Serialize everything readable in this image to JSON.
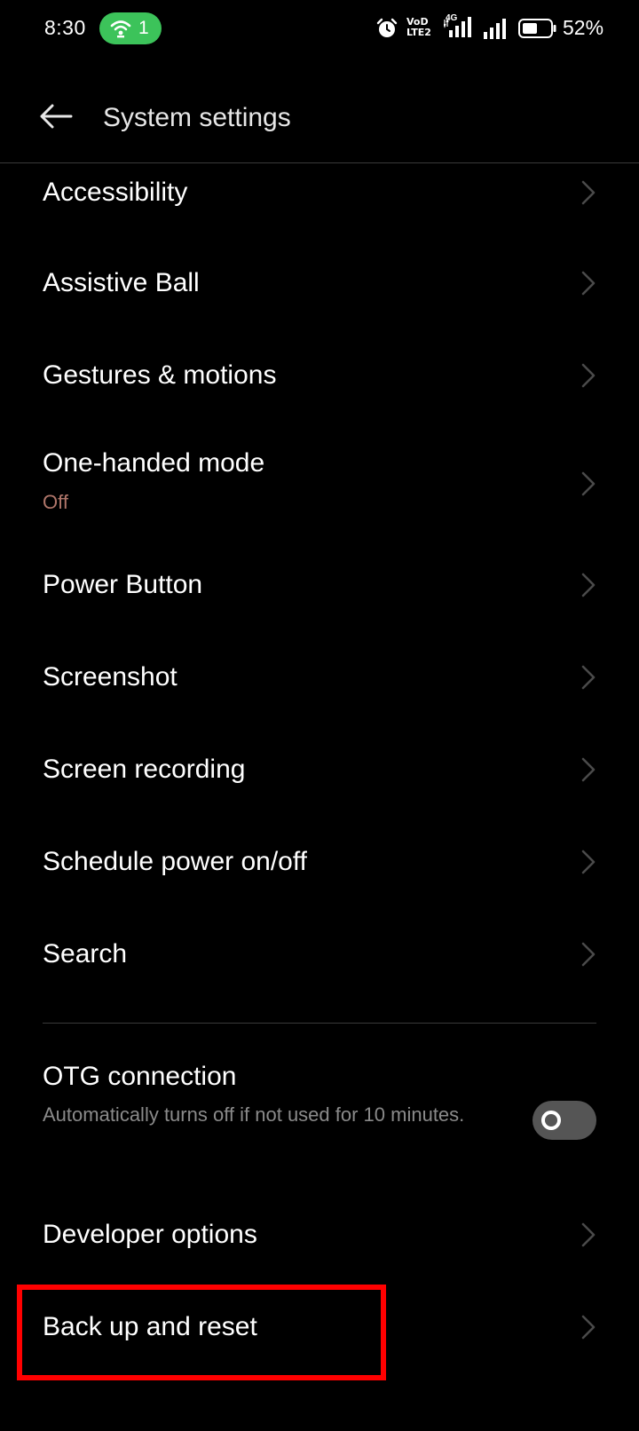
{
  "status_bar": {
    "time": "8:30",
    "hotspot_count": "1",
    "volte_line1": "VoD",
    "volte_line2": "LTE2",
    "network_type": "4G",
    "battery_percent": "52%"
  },
  "header": {
    "title": "System settings"
  },
  "items": [
    {
      "label": "Accessibility"
    },
    {
      "label": "Assistive Ball"
    },
    {
      "label": "Gestures & motions"
    },
    {
      "label": "One-handed mode",
      "subtitle": "Off"
    },
    {
      "label": "Power Button"
    },
    {
      "label": "Screenshot"
    },
    {
      "label": "Screen recording"
    },
    {
      "label": "Schedule power on/off"
    },
    {
      "label": "Search"
    },
    {
      "label": "OTG connection",
      "subtitle": "Automatically turns off if not used for 10 minutes.",
      "toggle_on": false
    },
    {
      "label": "Developer options"
    },
    {
      "label": "Back up and reset"
    }
  ],
  "colors": {
    "background": "#000000",
    "hotspot_pill": "#3cc35a",
    "subtitle_off": "#b0766a",
    "highlight": "#ff0000"
  }
}
